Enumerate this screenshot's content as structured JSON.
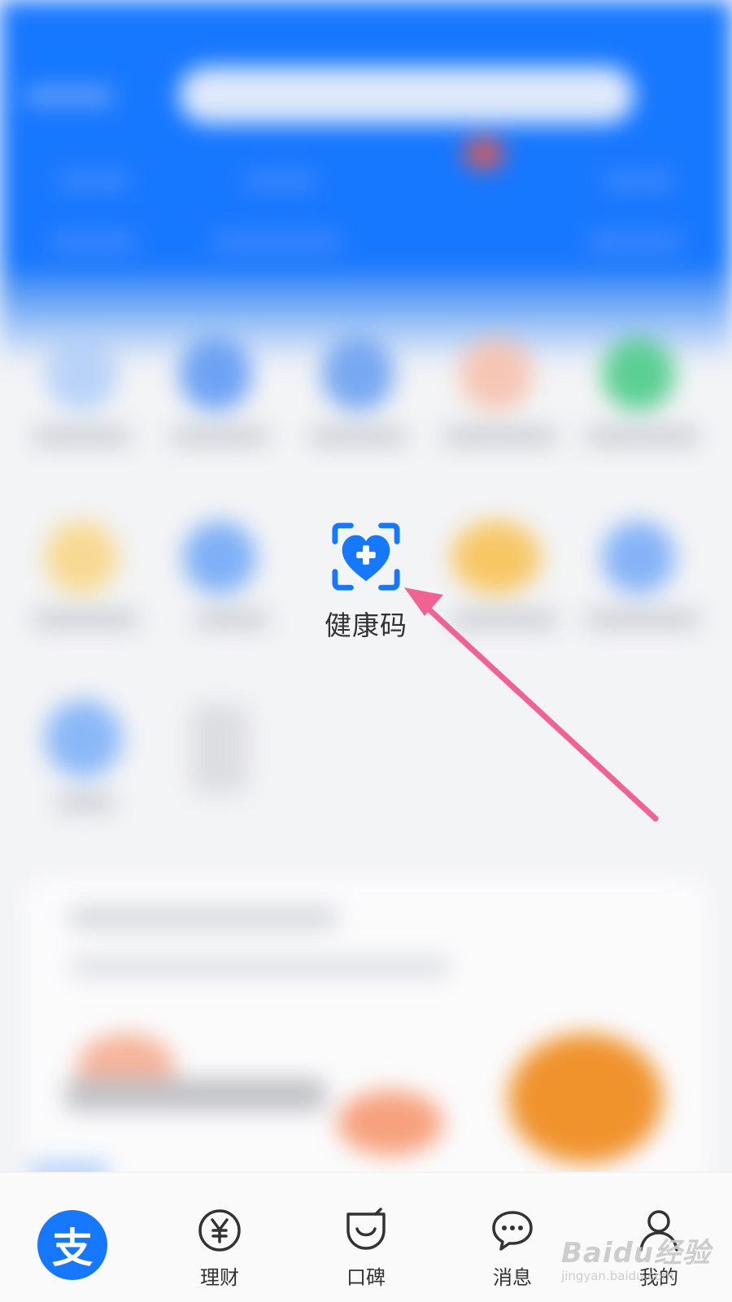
{
  "highlighted_app": {
    "label": "健康码",
    "accent": "#1677ff"
  },
  "tabbar": {
    "home_glyph": "支",
    "items": [
      {
        "label": "理财",
        "icon": "yen-circle-icon"
      },
      {
        "label": "口碑",
        "icon": "koubei-icon"
      },
      {
        "label": "消息",
        "icon": "chat-bubble-icon"
      },
      {
        "label": "我的",
        "icon": "person-icon"
      }
    ]
  },
  "watermark": {
    "line1": "Baidu经验",
    "line2": "jingyan.baidu.com"
  },
  "colors": {
    "brand": "#1677ff",
    "arrow": "#f06292"
  }
}
